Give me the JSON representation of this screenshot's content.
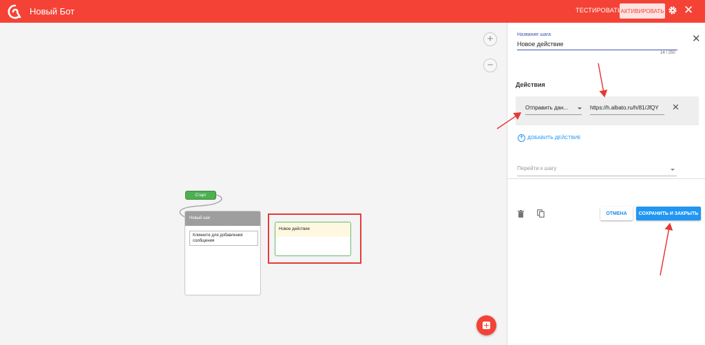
{
  "header": {
    "title": "Новый Бот",
    "test_label": "ТЕСТИРОВАТЬ",
    "activate_label": "АКТИВИРОВАТЬ",
    "brand_color": "#f44336"
  },
  "canvas": {
    "zoom_in": "+",
    "zoom_out": "−",
    "start_label": "Старт",
    "step": {
      "title": "Новый шаг",
      "message_placeholder": "Кликните для добавления сообщения"
    },
    "new_action_node_title": "Новое действие"
  },
  "panel": {
    "name_label": "Название шага",
    "name_value": "Новое действие",
    "counter": "14 / 250",
    "actions_title": "Действия",
    "action": {
      "type": "Отправить дан...",
      "url": "https://h.albato.ru/h/81/JfQY"
    },
    "add_action_label": "ДОБАВИТЬ ДЕЙСТВИЕ",
    "goto_placeholder": "Перейти к шагу",
    "cancel_label": "ОТМЕНА",
    "save_label": "СОХРАНИТЬ И ЗАКРЫТЬ"
  },
  "icons": {
    "logo": "app-logo-icon",
    "settings": "gear-icon",
    "close": "close-icon",
    "delete": "trash-icon",
    "copy": "copy-icon",
    "add": "plus-icon"
  }
}
